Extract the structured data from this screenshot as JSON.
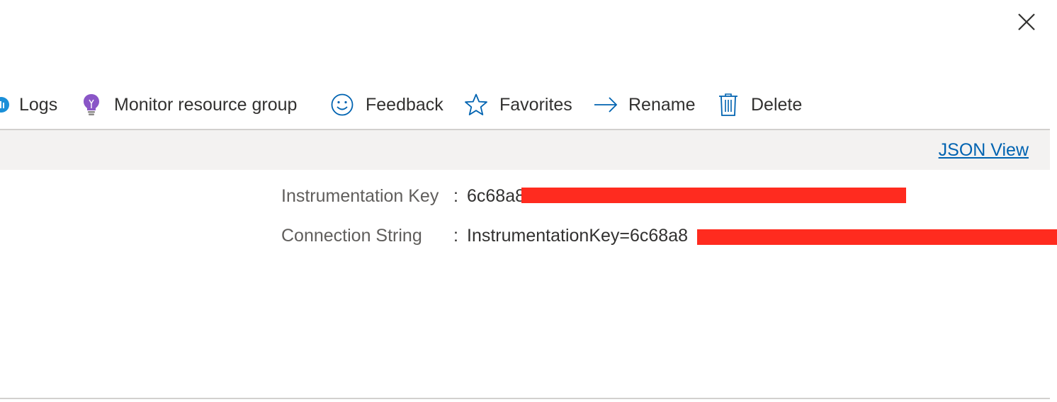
{
  "window": {
    "close_icon": "close-icon"
  },
  "toolbar": {
    "items": [
      {
        "label": "Logs",
        "icon": "logs-icon"
      },
      {
        "label": "Monitor resource group",
        "icon": "lightbulb-icon"
      },
      {
        "label": "Feedback",
        "icon": "smiley-icon"
      },
      {
        "label": "Favorites",
        "icon": "star-icon"
      },
      {
        "label": "Rename",
        "icon": "arrow-right-icon"
      },
      {
        "label": "Delete",
        "icon": "trash-icon"
      }
    ]
  },
  "essentials": {
    "json_view_label": "JSON View"
  },
  "properties": [
    {
      "label": "Instrumentation Key",
      "separator": ":",
      "value": "6c68a8"
    },
    {
      "label": "Connection String",
      "separator": ":",
      "value": "InstrumentationKey=6c68a8"
    }
  ],
  "colors": {
    "accent": "#0063b1",
    "redaction": "#ff2b1f",
    "command_bar_bg": "#f3f2f1",
    "lightbulb": "#8a56c7"
  }
}
